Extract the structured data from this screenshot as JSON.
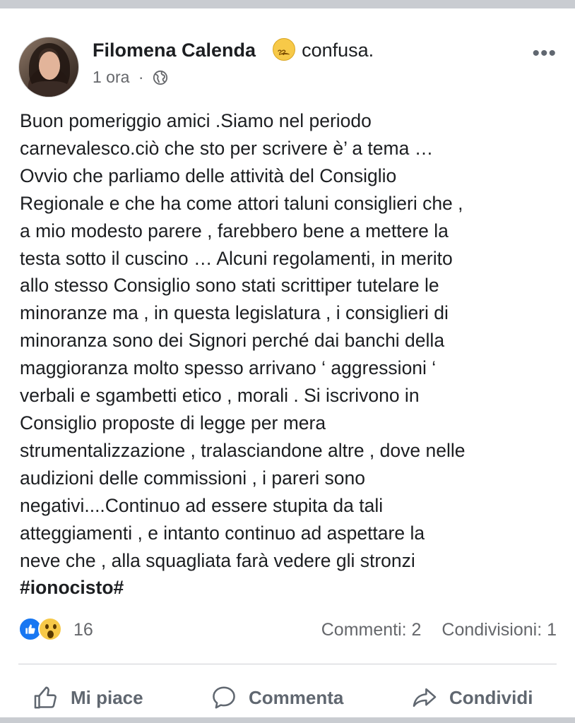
{
  "post": {
    "author": "Filomena Calenda",
    "feeling_icon": "confused-face-emoji",
    "feeling": "confusa.",
    "time": "1 ora",
    "separator": "·",
    "privacy_icon": "globe-icon",
    "more_icon": "•••",
    "text_lines": [
      "Buon pomeriggio amici .Siamo nel periodo",
      "carnevalesco.ciò che sto per scrivere è’ a tema …",
      "Ovvio che parliamo delle attività del Consiglio",
      "Regionale e che ha come attori taluni consiglieri che ,",
      "a mio modesto parere , farebbero bene a mettere la",
      "testa sotto il cuscino … Alcuni regolamenti, in merito",
      "allo stesso Consiglio sono stati scrittiper tutelare le",
      "minoranze ma , in questa legislatura , i consiglieri di",
      "minoranza sono dei Signori perché dai banchi della",
      "maggioranza molto spesso arrivano ‘ aggressioni ‘",
      "verbali e sgambetti etico , morali  . Si iscrivono in",
      "Consiglio proposte di legge per mera",
      "strumentalizzazione , tralasciandone altre , dove nelle",
      "audizioni delle commissioni , i pareri sono",
      "negativi....Continuo ad essere stupita da tali",
      "atteggiamenti , e intanto continuo ad aspettare la",
      "neve che , alla squagliata farà vedere gli stronzi"
    ],
    "hashtag": "#ionocisto#"
  },
  "stats": {
    "reaction_icons": [
      "like-icon",
      "wow-icon"
    ],
    "reaction_count": "16",
    "comments": "Commenti: 2",
    "shares": "Condivisioni: 1"
  },
  "actions": {
    "like": "Mi piace",
    "comment": "Commenta",
    "share": "Condividi"
  },
  "colors": {
    "background": "#c9ccd1",
    "card": "#ffffff",
    "text": "#1c1e21",
    "muted": "#65676b",
    "like_blue": "#1877f2"
  }
}
